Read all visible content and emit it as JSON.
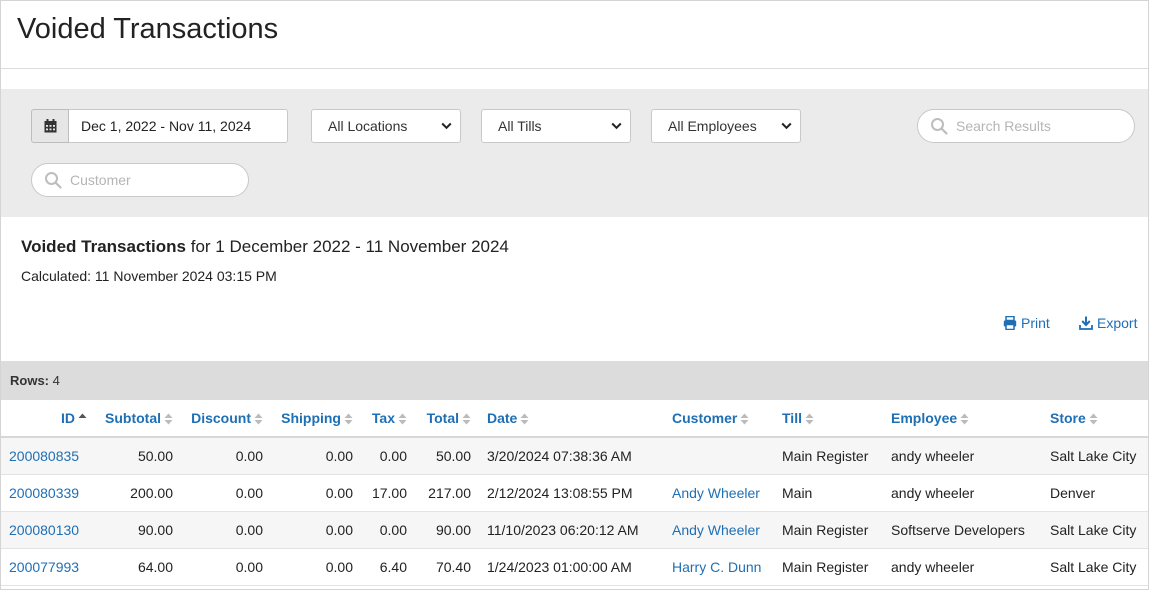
{
  "page": {
    "title": "Voided Transactions"
  },
  "filters": {
    "date_range": "Dec 1, 2022 - Nov 11, 2024",
    "location": "All Locations",
    "till": "All Tills",
    "employee": "All Employees",
    "search_placeholder": "Search Results",
    "customer_placeholder": "Customer"
  },
  "report": {
    "title": "Voided Transactions",
    "title_suffix": "for 1 December 2022 - 11 November 2024",
    "calculated": "Calculated: 11 November 2024 03:15 PM",
    "print_label": "Print",
    "export_label": "Export"
  },
  "rows_info": {
    "label": "Rows:",
    "count": "4"
  },
  "colors": {
    "link": "#1f6fb5",
    "filter_bg": "#ebebeb",
    "rows_bar_bg": "#dcdcdc"
  },
  "table": {
    "columns": [
      "ID",
      "Subtotal",
      "Discount",
      "Shipping",
      "Tax",
      "Total",
      "Date",
      "Customer",
      "Till",
      "Employee",
      "Store"
    ],
    "rows": [
      {
        "id": "200080835",
        "subtotal": "50.00",
        "discount": "0.00",
        "shipping": "0.00",
        "tax": "0.00",
        "total": "50.00",
        "date": "3/20/2024 07:38:36 AM",
        "customer": "",
        "till": "Main Register",
        "employee": "andy wheeler",
        "store": "Salt Lake City"
      },
      {
        "id": "200080339",
        "subtotal": "200.00",
        "discount": "0.00",
        "shipping": "0.00",
        "tax": "17.00",
        "total": "217.00",
        "date": "2/12/2024 13:08:55 PM",
        "customer": "Andy Wheeler",
        "till": "Main",
        "employee": "andy wheeler",
        "store": "Denver"
      },
      {
        "id": "200080130",
        "subtotal": "90.00",
        "discount": "0.00",
        "shipping": "0.00",
        "tax": "0.00",
        "total": "90.00",
        "date": "11/10/2023 06:20:12 AM",
        "customer": "Andy Wheeler",
        "till": "Main Register",
        "employee": "Softserve Developers",
        "store": "Salt Lake City"
      },
      {
        "id": "200077993",
        "subtotal": "64.00",
        "discount": "0.00",
        "shipping": "0.00",
        "tax": "6.40",
        "total": "70.40",
        "date": "1/24/2023 01:00:00 AM",
        "customer": "Harry C. Dunn",
        "till": "Main Register",
        "employee": "andy wheeler",
        "store": "Salt Lake City"
      }
    ]
  }
}
